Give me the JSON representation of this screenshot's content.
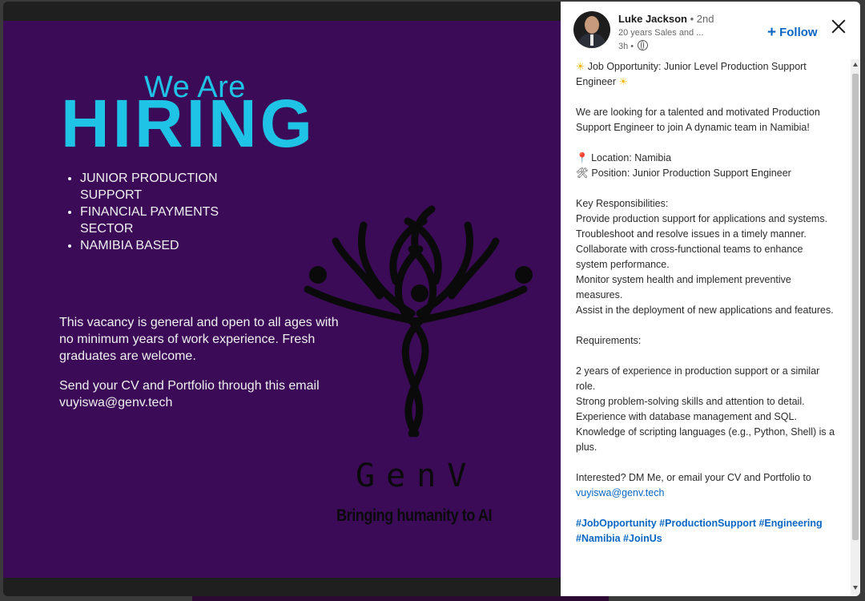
{
  "poster": {
    "we_are": "We Are",
    "hiring": "HIRING",
    "bullets": [
      "JUNIOR PRODUCTION SUPPORT",
      "FINANCIAL PAYMENTS SECTOR",
      "NAMIBIA BASED"
    ],
    "vacancy": "This vacancy is general and open to all ages with no minimum years of work experience. Fresh graduates are welcome.",
    "send_line": "Send your CV and Portfolio through this email",
    "email": "vuyiswa@genv.tech",
    "brand": "GenV",
    "tagline": "Bringing humanity to AI",
    "colors": {
      "background": "#3b0b57",
      "accent": "#1fc3e6"
    }
  },
  "author": {
    "name": "Luke Jackson",
    "degree": " • 2nd",
    "headline": "20 years Sales and ...",
    "time": "3h •"
  },
  "actions": {
    "follow_label": "Follow"
  },
  "post": {
    "title_line1": "Job Opportunity: Junior Level Production Support",
    "title_line2": "Engineer",
    "intro": "We are looking for a talented and motivated Production Support Engineer to join A dynamic team in Namibia!",
    "location": "Location: Namibia",
    "position": "Position: Junior Production Support Engineer",
    "responsibilities_heading": "Key Responsibilities:",
    "responsibilities": [
      "Provide production support for applications and systems.",
      "Troubleshoot and resolve issues in a timely manner.",
      "Collaborate with cross-functional teams to enhance system performance.",
      "Monitor system health and implement preventive measures.",
      "Assist in the deployment of new applications and features."
    ],
    "requirements_heading": "Requirements:",
    "requirements": [
      "2 years of experience in production support or a similar role.",
      "Strong problem-solving skills and attention to detail.",
      "Experience with database management and SQL.",
      "Knowledge of scripting languages (e.g., Python, Shell) is a plus."
    ],
    "cta": "Interested? DM Me, or email your CV and Portfolio to",
    "cta_email": "vuyiswa@genv.tech",
    "hashtags": "#JobOpportunity #ProductionSupport #Engineering #Namibia #JoinUs"
  }
}
